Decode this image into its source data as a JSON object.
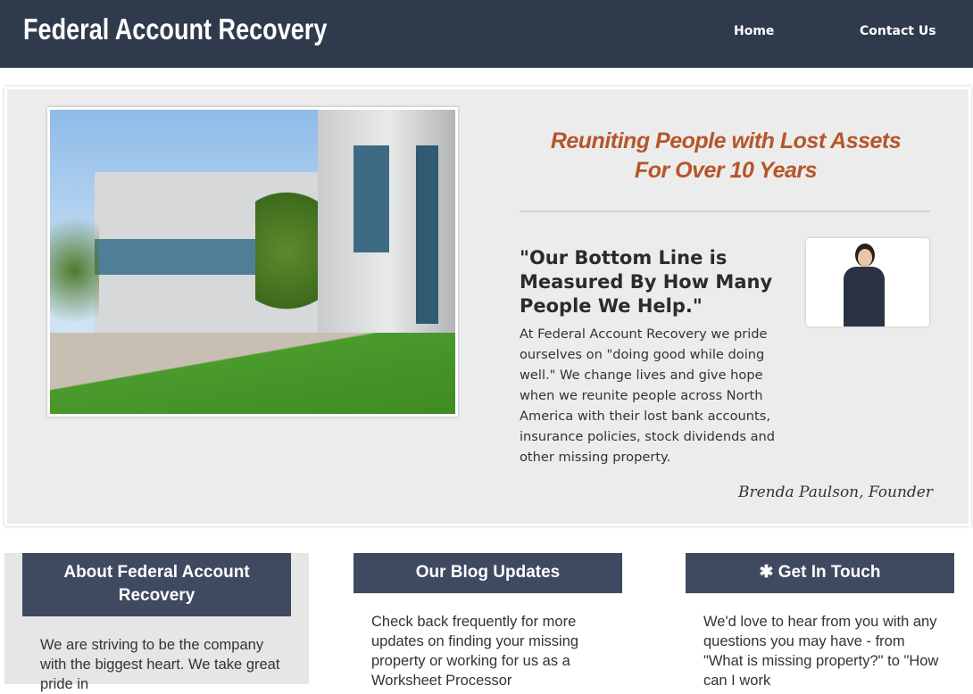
{
  "header": {
    "title": "Federal Account Recovery",
    "nav": [
      {
        "label": "Home"
      },
      {
        "label": "Contact Us"
      }
    ]
  },
  "hero": {
    "tagline_line1": "Reuniting People with Lost Assets",
    "tagline_line2": "For Over 10 Years",
    "quote": "\"Our Bottom Line is Measured By How Many People We Help.\"",
    "body": "At Federal Account Recovery we pride ourselves on \"doing good while doing well.\"  We change lives and give hope when we reunite people across North America with their lost bank accounts, insurance policies, stock dividends and other missing property.",
    "signature": "Brenda Paulson, Founder",
    "accent": "#b5562a"
  },
  "columns": [
    {
      "title": "About Federal Account Recovery",
      "text": "We are striving to be the company with the biggest heart.  We take great pride in"
    },
    {
      "title": "Our Blog Updates",
      "text": "Check back frequently for more updates on finding your missing property or working for us as a Worksheet Processor"
    },
    {
      "title": "Get In Touch",
      "icon": "asterisk-icon",
      "text": "We'd love to hear from you with any questions you may have - from \"What is missing property?\" to \"How can I work"
    }
  ],
  "colors": {
    "header": "#2f3a4d",
    "column_header": "#3f4a60"
  }
}
